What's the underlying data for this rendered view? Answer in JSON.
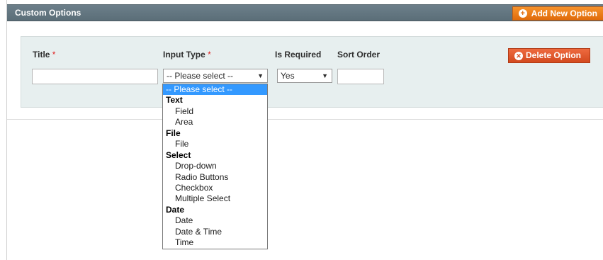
{
  "header": {
    "title": "Custom Options",
    "add_button": "Add New Option",
    "accent": "#eb7c1c"
  },
  "option": {
    "title_label": "Title",
    "input_type_label": "Input Type",
    "required_mark": "*",
    "is_required_label": "Is Required",
    "sort_order_label": "Sort Order",
    "title_value": "",
    "sort_order_value": "",
    "input_type_selected": "-- Please select --",
    "is_required_selected": "Yes",
    "delete_button": "Delete Option"
  },
  "dropdown": {
    "items": [
      {
        "label": "-- Please select --",
        "kind": "selected"
      },
      {
        "label": "Text",
        "kind": "group"
      },
      {
        "label": "Field",
        "kind": "opt"
      },
      {
        "label": "Area",
        "kind": "opt"
      },
      {
        "label": "File",
        "kind": "group"
      },
      {
        "label": "File",
        "kind": "opt"
      },
      {
        "label": "Select",
        "kind": "group"
      },
      {
        "label": "Drop-down",
        "kind": "opt"
      },
      {
        "label": "Radio Buttons",
        "kind": "opt"
      },
      {
        "label": "Checkbox",
        "kind": "opt"
      },
      {
        "label": "Multiple Select",
        "kind": "opt"
      },
      {
        "label": "Date",
        "kind": "group"
      },
      {
        "label": "Date",
        "kind": "opt"
      },
      {
        "label": "Date & Time",
        "kind": "opt"
      },
      {
        "label": "Time",
        "kind": "opt"
      }
    ]
  }
}
